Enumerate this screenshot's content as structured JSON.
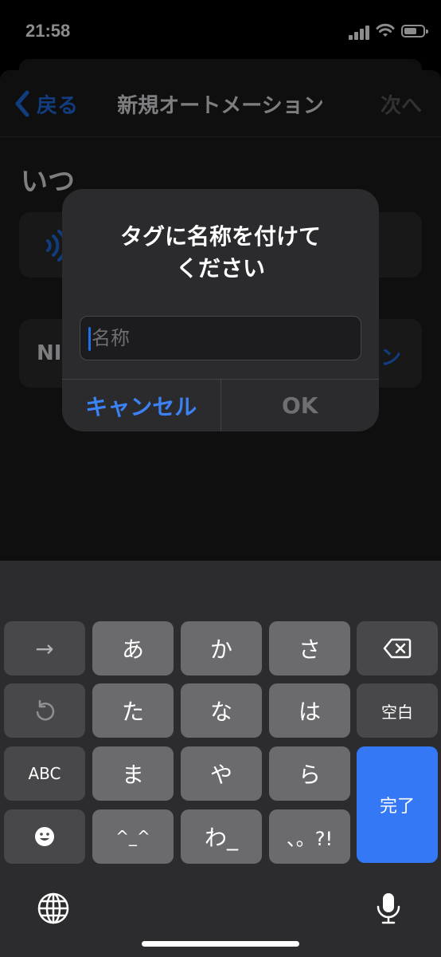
{
  "status": {
    "time": "21:58"
  },
  "nav": {
    "back_label": "戻る",
    "title": "新規オートメーション",
    "next_label": "次へ"
  },
  "section": {
    "title": "いつ"
  },
  "background_cards": {
    "card2_label": "NI",
    "card2_action": "ン"
  },
  "alert": {
    "title_line1": "タグに名称を付けて",
    "title_line2": "ください",
    "input_placeholder": "名称",
    "input_value": "",
    "cancel_label": "キャンセル",
    "ok_label": "OK"
  },
  "keyboard": {
    "rows": [
      [
        "→",
        "あ",
        "か",
        "さ",
        "delete-icon"
      ],
      [
        "undo-icon",
        "た",
        "な",
        "は",
        "空白"
      ],
      [
        "ABC",
        "ま",
        "や",
        "ら",
        "完了"
      ],
      [
        "emoji-icon",
        "^_^",
        "わ_",
        "、。?!"
      ]
    ],
    "k_arrow": "→",
    "k_a": "あ",
    "k_ka": "か",
    "k_sa": "さ",
    "k_ta": "た",
    "k_na": "な",
    "k_ha": "は",
    "k_space": "空白",
    "k_abc": "ABC",
    "k_ma": "ま",
    "k_ya": "や",
    "k_ra": "ら",
    "k_done": "完了",
    "k_kao": "^_^",
    "k_wa": "わ_",
    "k_punct": "、。?!"
  },
  "colors": {
    "accent": "#1f6fe8",
    "done_key": "#3478f6",
    "alert_bg": "#2b2b2d"
  }
}
